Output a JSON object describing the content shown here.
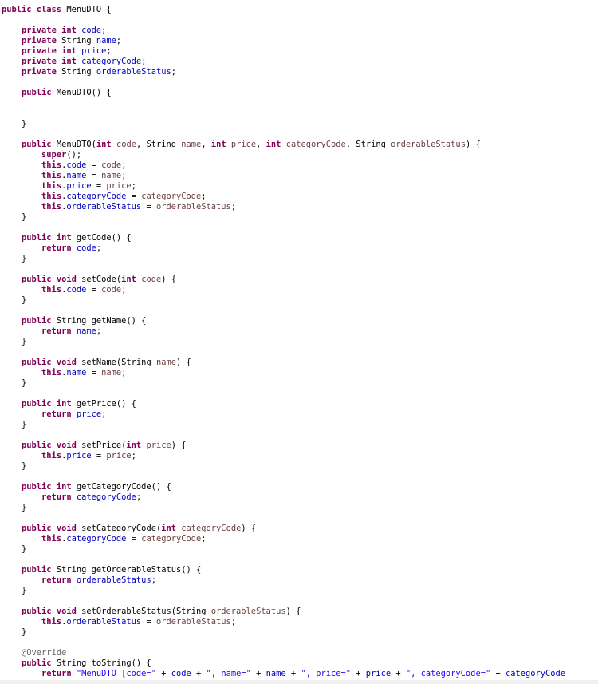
{
  "editor": {
    "file_class": "MenuDTO",
    "lines": [
      [
        {
          "t": "public class",
          "c": "kw"
        },
        {
          "t": " MenuDTO {",
          "c": "pl"
        }
      ],
      [],
      [
        {
          "t": "    ",
          "c": "pl"
        },
        {
          "t": "private int",
          "c": "kw"
        },
        {
          "t": " ",
          "c": "pl"
        },
        {
          "t": "code",
          "c": "fld"
        },
        {
          "t": ";",
          "c": "pl"
        }
      ],
      [
        {
          "t": "    ",
          "c": "pl"
        },
        {
          "t": "private",
          "c": "kw"
        },
        {
          "t": " String ",
          "c": "pl"
        },
        {
          "t": "name",
          "c": "fld"
        },
        {
          "t": ";",
          "c": "pl"
        }
      ],
      [
        {
          "t": "    ",
          "c": "pl"
        },
        {
          "t": "private int",
          "c": "kw"
        },
        {
          "t": " ",
          "c": "pl"
        },
        {
          "t": "price",
          "c": "fld"
        },
        {
          "t": ";",
          "c": "pl"
        }
      ],
      [
        {
          "t": "    ",
          "c": "pl"
        },
        {
          "t": "private int",
          "c": "kw"
        },
        {
          "t": " ",
          "c": "pl"
        },
        {
          "t": "categoryCode",
          "c": "fld"
        },
        {
          "t": ";",
          "c": "pl"
        }
      ],
      [
        {
          "t": "    ",
          "c": "pl"
        },
        {
          "t": "private",
          "c": "kw"
        },
        {
          "t": " String ",
          "c": "pl"
        },
        {
          "t": "orderableStatus",
          "c": "fld"
        },
        {
          "t": ";",
          "c": "pl"
        }
      ],
      [],
      [
        {
          "t": "    ",
          "c": "pl"
        },
        {
          "t": "public",
          "c": "kw"
        },
        {
          "t": " MenuDTO() {",
          "c": "pl"
        }
      ],
      [],
      [],
      [
        {
          "t": "    }",
          "c": "pl"
        }
      ],
      [],
      [
        {
          "t": "    ",
          "c": "pl"
        },
        {
          "t": "public",
          "c": "kw"
        },
        {
          "t": " MenuDTO(",
          "c": "pl"
        },
        {
          "t": "int",
          "c": "kw"
        },
        {
          "t": " ",
          "c": "pl"
        },
        {
          "t": "code",
          "c": "prm"
        },
        {
          "t": ", String ",
          "c": "pl"
        },
        {
          "t": "name",
          "c": "prm"
        },
        {
          "t": ", ",
          "c": "pl"
        },
        {
          "t": "int",
          "c": "kw"
        },
        {
          "t": " ",
          "c": "pl"
        },
        {
          "t": "price",
          "c": "prm"
        },
        {
          "t": ", ",
          "c": "pl"
        },
        {
          "t": "int",
          "c": "kw"
        },
        {
          "t": " ",
          "c": "pl"
        },
        {
          "t": "categoryCode",
          "c": "prm"
        },
        {
          "t": ", String ",
          "c": "pl"
        },
        {
          "t": "orderableStatus",
          "c": "prm"
        },
        {
          "t": ") {",
          "c": "pl"
        }
      ],
      [
        {
          "t": "        ",
          "c": "pl"
        },
        {
          "t": "super",
          "c": "kw"
        },
        {
          "t": "();",
          "c": "pl"
        }
      ],
      [
        {
          "t": "        ",
          "c": "pl"
        },
        {
          "t": "this",
          "c": "kw"
        },
        {
          "t": ".",
          "c": "pl"
        },
        {
          "t": "code",
          "c": "fld"
        },
        {
          "t": " = ",
          "c": "pl"
        },
        {
          "t": "code",
          "c": "prm"
        },
        {
          "t": ";",
          "c": "pl"
        }
      ],
      [
        {
          "t": "        ",
          "c": "pl"
        },
        {
          "t": "this",
          "c": "kw"
        },
        {
          "t": ".",
          "c": "pl"
        },
        {
          "t": "name",
          "c": "fld"
        },
        {
          "t": " = ",
          "c": "pl"
        },
        {
          "t": "name",
          "c": "prm"
        },
        {
          "t": ";",
          "c": "pl"
        }
      ],
      [
        {
          "t": "        ",
          "c": "pl"
        },
        {
          "t": "this",
          "c": "kw"
        },
        {
          "t": ".",
          "c": "pl"
        },
        {
          "t": "price",
          "c": "fld"
        },
        {
          "t": " = ",
          "c": "pl"
        },
        {
          "t": "price",
          "c": "prm"
        },
        {
          "t": ";",
          "c": "pl"
        }
      ],
      [
        {
          "t": "        ",
          "c": "pl"
        },
        {
          "t": "this",
          "c": "kw"
        },
        {
          "t": ".",
          "c": "pl"
        },
        {
          "t": "categoryCode",
          "c": "fld"
        },
        {
          "t": " = ",
          "c": "pl"
        },
        {
          "t": "categoryCode",
          "c": "prm"
        },
        {
          "t": ";",
          "c": "pl"
        }
      ],
      [
        {
          "t": "        ",
          "c": "pl"
        },
        {
          "t": "this",
          "c": "kw"
        },
        {
          "t": ".",
          "c": "pl"
        },
        {
          "t": "orderableStatus",
          "c": "fld"
        },
        {
          "t": " = ",
          "c": "pl"
        },
        {
          "t": "orderableStatus",
          "c": "prm"
        },
        {
          "t": ";",
          "c": "pl"
        }
      ],
      [
        {
          "t": "    }",
          "c": "pl"
        }
      ],
      [],
      [
        {
          "t": "    ",
          "c": "pl"
        },
        {
          "t": "public int",
          "c": "kw"
        },
        {
          "t": " getCode() {",
          "c": "pl"
        }
      ],
      [
        {
          "t": "        ",
          "c": "pl"
        },
        {
          "t": "return",
          "c": "kw"
        },
        {
          "t": " ",
          "c": "pl"
        },
        {
          "t": "code",
          "c": "fld"
        },
        {
          "t": ";",
          "c": "pl"
        }
      ],
      [
        {
          "t": "    }",
          "c": "pl"
        }
      ],
      [],
      [
        {
          "t": "    ",
          "c": "pl"
        },
        {
          "t": "public void",
          "c": "kw"
        },
        {
          "t": " setCode(",
          "c": "pl"
        },
        {
          "t": "int",
          "c": "kw"
        },
        {
          "t": " ",
          "c": "pl"
        },
        {
          "t": "code",
          "c": "prm"
        },
        {
          "t": ") {",
          "c": "pl"
        }
      ],
      [
        {
          "t": "        ",
          "c": "pl"
        },
        {
          "t": "this",
          "c": "kw"
        },
        {
          "t": ".",
          "c": "pl"
        },
        {
          "t": "code",
          "c": "fld"
        },
        {
          "t": " = ",
          "c": "pl"
        },
        {
          "t": "code",
          "c": "prm"
        },
        {
          "t": ";",
          "c": "pl"
        }
      ],
      [
        {
          "t": "    }",
          "c": "pl"
        }
      ],
      [],
      [
        {
          "t": "    ",
          "c": "pl"
        },
        {
          "t": "public",
          "c": "kw"
        },
        {
          "t": " String getName() {",
          "c": "pl"
        }
      ],
      [
        {
          "t": "        ",
          "c": "pl"
        },
        {
          "t": "return",
          "c": "kw"
        },
        {
          "t": " ",
          "c": "pl"
        },
        {
          "t": "name",
          "c": "fld"
        },
        {
          "t": ";",
          "c": "pl"
        }
      ],
      [
        {
          "t": "    }",
          "c": "pl"
        }
      ],
      [],
      [
        {
          "t": "    ",
          "c": "pl"
        },
        {
          "t": "public void",
          "c": "kw"
        },
        {
          "t": " setName(String ",
          "c": "pl"
        },
        {
          "t": "name",
          "c": "prm"
        },
        {
          "t": ") {",
          "c": "pl"
        }
      ],
      [
        {
          "t": "        ",
          "c": "pl"
        },
        {
          "t": "this",
          "c": "kw"
        },
        {
          "t": ".",
          "c": "pl"
        },
        {
          "t": "name",
          "c": "fld"
        },
        {
          "t": " = ",
          "c": "pl"
        },
        {
          "t": "name",
          "c": "prm"
        },
        {
          "t": ";",
          "c": "pl"
        }
      ],
      [
        {
          "t": "    }",
          "c": "pl"
        }
      ],
      [],
      [
        {
          "t": "    ",
          "c": "pl"
        },
        {
          "t": "public int",
          "c": "kw"
        },
        {
          "t": " getPrice() {",
          "c": "pl"
        }
      ],
      [
        {
          "t": "        ",
          "c": "pl"
        },
        {
          "t": "return",
          "c": "kw"
        },
        {
          "t": " ",
          "c": "pl"
        },
        {
          "t": "price",
          "c": "fld"
        },
        {
          "t": ";",
          "c": "pl"
        }
      ],
      [
        {
          "t": "    }",
          "c": "pl"
        }
      ],
      [],
      [
        {
          "t": "    ",
          "c": "pl"
        },
        {
          "t": "public void",
          "c": "kw"
        },
        {
          "t": " setPrice(",
          "c": "pl"
        },
        {
          "t": "int",
          "c": "kw"
        },
        {
          "t": " ",
          "c": "pl"
        },
        {
          "t": "price",
          "c": "prm"
        },
        {
          "t": ") {",
          "c": "pl"
        }
      ],
      [
        {
          "t": "        ",
          "c": "pl"
        },
        {
          "t": "this",
          "c": "kw"
        },
        {
          "t": ".",
          "c": "pl"
        },
        {
          "t": "price",
          "c": "fld"
        },
        {
          "t": " = ",
          "c": "pl"
        },
        {
          "t": "price",
          "c": "prm"
        },
        {
          "t": ";",
          "c": "pl"
        }
      ],
      [
        {
          "t": "    }",
          "c": "pl"
        }
      ],
      [],
      [
        {
          "t": "    ",
          "c": "pl"
        },
        {
          "t": "public int",
          "c": "kw"
        },
        {
          "t": " getCategoryCode() {",
          "c": "pl"
        }
      ],
      [
        {
          "t": "        ",
          "c": "pl"
        },
        {
          "t": "return",
          "c": "kw"
        },
        {
          "t": " ",
          "c": "pl"
        },
        {
          "t": "categoryCode",
          "c": "fld"
        },
        {
          "t": ";",
          "c": "pl"
        }
      ],
      [
        {
          "t": "    }",
          "c": "pl"
        }
      ],
      [],
      [
        {
          "t": "    ",
          "c": "pl"
        },
        {
          "t": "public void",
          "c": "kw"
        },
        {
          "t": " setCategoryCode(",
          "c": "pl"
        },
        {
          "t": "int",
          "c": "kw"
        },
        {
          "t": " ",
          "c": "pl"
        },
        {
          "t": "categoryCode",
          "c": "prm"
        },
        {
          "t": ") {",
          "c": "pl"
        }
      ],
      [
        {
          "t": "        ",
          "c": "pl"
        },
        {
          "t": "this",
          "c": "kw"
        },
        {
          "t": ".",
          "c": "pl"
        },
        {
          "t": "categoryCode",
          "c": "fld"
        },
        {
          "t": " = ",
          "c": "pl"
        },
        {
          "t": "categoryCode",
          "c": "prm"
        },
        {
          "t": ";",
          "c": "pl"
        }
      ],
      [
        {
          "t": "    }",
          "c": "pl"
        }
      ],
      [],
      [
        {
          "t": "    ",
          "c": "pl"
        },
        {
          "t": "public",
          "c": "kw"
        },
        {
          "t": " String getOrderableStatus() {",
          "c": "pl"
        }
      ],
      [
        {
          "t": "        ",
          "c": "pl"
        },
        {
          "t": "return",
          "c": "kw"
        },
        {
          "t": " ",
          "c": "pl"
        },
        {
          "t": "orderableStatus",
          "c": "fld"
        },
        {
          "t": ";",
          "c": "pl"
        }
      ],
      [
        {
          "t": "    }",
          "c": "pl"
        }
      ],
      [],
      [
        {
          "t": "    ",
          "c": "pl"
        },
        {
          "t": "public void",
          "c": "kw"
        },
        {
          "t": " setOrderableStatus(String ",
          "c": "pl"
        },
        {
          "t": "orderableStatus",
          "c": "prm"
        },
        {
          "t": ") {",
          "c": "pl"
        }
      ],
      [
        {
          "t": "        ",
          "c": "pl"
        },
        {
          "t": "this",
          "c": "kw"
        },
        {
          "t": ".",
          "c": "pl"
        },
        {
          "t": "orderableStatus",
          "c": "fld"
        },
        {
          "t": " = ",
          "c": "pl"
        },
        {
          "t": "orderableStatus",
          "c": "prm"
        },
        {
          "t": ";",
          "c": "pl"
        }
      ],
      [
        {
          "t": "    }",
          "c": "pl"
        }
      ],
      [],
      [
        {
          "t": "    ",
          "c": "pl"
        },
        {
          "t": "@Override",
          "c": "ann"
        }
      ],
      [
        {
          "t": "    ",
          "c": "pl"
        },
        {
          "t": "public",
          "c": "kw"
        },
        {
          "t": " String toString() {",
          "c": "pl"
        }
      ],
      [
        {
          "t": "        ",
          "c": "pl"
        },
        {
          "t": "return",
          "c": "kw"
        },
        {
          "t": " ",
          "c": "pl"
        },
        {
          "t": "\"MenuDTO [code=\"",
          "c": "str"
        },
        {
          "t": " + ",
          "c": "pl"
        },
        {
          "t": "code",
          "c": "fld"
        },
        {
          "t": " + ",
          "c": "pl"
        },
        {
          "t": "\", name=\"",
          "c": "str"
        },
        {
          "t": " + ",
          "c": "pl"
        },
        {
          "t": "name",
          "c": "fld"
        },
        {
          "t": " + ",
          "c": "pl"
        },
        {
          "t": "\", price=\"",
          "c": "str"
        },
        {
          "t": " + ",
          "c": "pl"
        },
        {
          "t": "price",
          "c": "fld"
        },
        {
          "t": " + ",
          "c": "pl"
        },
        {
          "t": "\", categoryCode=\"",
          "c": "str"
        },
        {
          "t": " + ",
          "c": "pl"
        },
        {
          "t": "categoryCode",
          "c": "fld"
        }
      ]
    ]
  },
  "colors": {
    "background": "#ffffff",
    "keyword": "#7f0055",
    "field": "#0000c0",
    "parameter": "#6a3e3e",
    "string": "#2a00ff",
    "annotation": "#646464",
    "plain": "#000000"
  }
}
